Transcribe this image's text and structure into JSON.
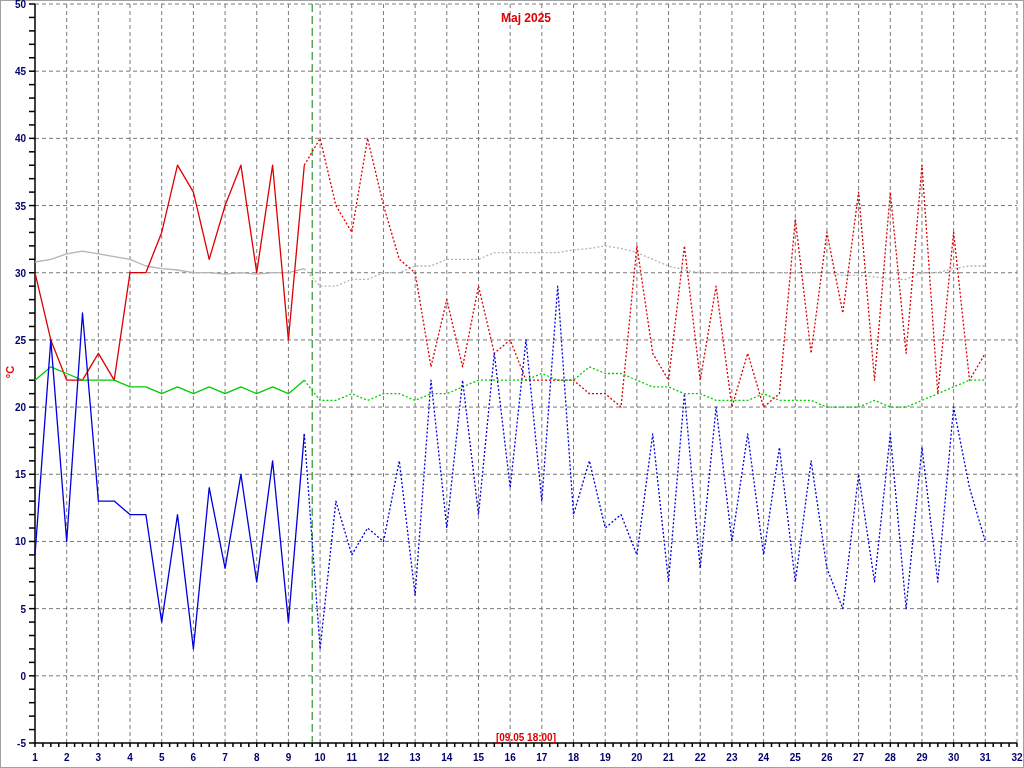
{
  "chart": {
    "chart_data": {
      "type": "line",
      "title": "Maj 2025",
      "ylabel": "°C",
      "x": [
        1,
        1.5,
        2,
        2.5,
        3,
        3.5,
        4,
        4.5,
        5,
        5.5,
        6,
        6.5,
        7,
        7.5,
        8,
        8.5,
        9,
        9.5,
        10,
        10.5,
        11,
        11.5,
        12,
        12.5,
        13,
        13.5,
        14,
        14.5,
        15,
        15.5,
        16,
        16.5,
        17,
        17.5,
        18,
        18.5,
        19,
        19.5,
        20,
        20.5,
        21,
        21.5,
        22,
        22.5,
        23,
        23.5,
        24,
        24.5,
        25,
        25.5,
        26,
        26.5,
        27,
        27.5,
        28,
        28.5,
        29,
        29.5,
        30,
        30.5,
        31
      ],
      "xlim": [
        1,
        32
      ],
      "ylim": [
        -5,
        50
      ],
      "xticks": [
        1,
        2,
        3,
        4,
        5,
        6,
        7,
        8,
        9,
        10,
        11,
        12,
        13,
        14,
        15,
        16,
        17,
        18,
        19,
        20,
        21,
        22,
        23,
        24,
        25,
        26,
        27,
        28,
        29,
        30,
        31,
        32
      ],
      "yticks": [
        -5,
        0,
        5,
        10,
        15,
        20,
        25,
        30,
        35,
        40,
        45,
        50
      ],
      "series": [
        {
          "color": "#b4b4b4",
          "line_style": "solid",
          "values": [
            30.8,
            31,
            31.4,
            31.6,
            31.4,
            31.2,
            31,
            30.5,
            30.3,
            30.2,
            30,
            30,
            29.9,
            30,
            29.9,
            30,
            30,
            30.3,
            null,
            null,
            null,
            null,
            null,
            null,
            null,
            null,
            null,
            null,
            null,
            null,
            null,
            null,
            null,
            null,
            null,
            null,
            null,
            null,
            null,
            null,
            null,
            null,
            null,
            null,
            null,
            null,
            null,
            null,
            null,
            null,
            null,
            null,
            null,
            null,
            null,
            null,
            null,
            null,
            null,
            null,
            null
          ]
        },
        {
          "color": "#b4b4b4",
          "line_style": "dotted",
          "values": [
            null,
            null,
            null,
            null,
            null,
            null,
            null,
            null,
            null,
            null,
            null,
            null,
            null,
            null,
            null,
            null,
            null,
            30.3,
            29,
            29,
            29.5,
            29.5,
            30,
            30,
            30.5,
            30.5,
            31,
            31,
            31,
            31.5,
            31.5,
            31.5,
            31.5,
            31.5,
            31.7,
            31.8,
            32,
            31.8,
            31.5,
            31,
            30.5,
            30.2,
            30,
            30,
            30,
            30,
            30,
            30,
            30,
            30,
            30,
            29.8,
            29.8,
            29.7,
            29.5,
            29.5,
            30,
            30,
            30.3,
            30.5,
            30.5
          ]
        },
        {
          "color": "#dd0000",
          "line_style": "solid",
          "values": [
            30,
            25,
            22,
            22,
            24,
            22,
            30,
            30,
            33,
            38,
            36,
            31,
            35,
            38,
            30,
            38,
            25,
            38,
            null,
            null,
            null,
            null,
            null,
            null,
            null,
            null,
            null,
            null,
            null,
            null,
            null,
            null,
            null,
            null,
            null,
            null,
            null,
            null,
            null,
            null,
            null,
            null,
            null,
            null,
            null,
            null,
            null,
            null,
            null,
            null,
            null,
            null,
            null,
            null,
            null,
            null,
            null,
            null,
            null,
            null,
            null
          ]
        },
        {
          "color": "#dd0000",
          "line_style": "dotted",
          "values": [
            null,
            null,
            null,
            null,
            null,
            null,
            null,
            null,
            null,
            null,
            null,
            null,
            null,
            null,
            null,
            null,
            null,
            38,
            40,
            35,
            33,
            40,
            35,
            31,
            30,
            23,
            28,
            23,
            29,
            24,
            25,
            22,
            22,
            22,
            22,
            21,
            21,
            20,
            32,
            24,
            22,
            32,
            22,
            29,
            20,
            24,
            20,
            21,
            34,
            24,
            33,
            27,
            36,
            22,
            36,
            24,
            38,
            21,
            33,
            22,
            24
          ]
        },
        {
          "color": "#00cc00",
          "line_style": "solid",
          "values": [
            22,
            23,
            22.5,
            22,
            22,
            22,
            21.5,
            21.5,
            21,
            21.5,
            21,
            21.5,
            21,
            21.5,
            21,
            21.5,
            21,
            22,
            null,
            null,
            null,
            null,
            null,
            null,
            null,
            null,
            null,
            null,
            null,
            null,
            null,
            null,
            null,
            null,
            null,
            null,
            null,
            null,
            null,
            null,
            null,
            null,
            null,
            null,
            null,
            null,
            null,
            null,
            null,
            null,
            null,
            null,
            null,
            null,
            null,
            null,
            null,
            null,
            null,
            null,
            null
          ]
        },
        {
          "color": "#00cc00",
          "line_style": "dotted",
          "values": [
            null,
            null,
            null,
            null,
            null,
            null,
            null,
            null,
            null,
            null,
            null,
            null,
            null,
            null,
            null,
            null,
            null,
            22,
            20.5,
            20.5,
            21,
            20.5,
            21,
            21,
            20.5,
            21,
            21,
            21.5,
            22,
            22,
            22,
            22,
            22.5,
            22,
            22,
            23,
            22.5,
            22.5,
            22,
            21.5,
            21.5,
            21,
            21,
            20.5,
            20.5,
            20.5,
            21,
            20.5,
            20.5,
            20.5,
            20,
            20,
            20,
            20.5,
            20,
            20,
            20.5,
            21,
            21.5,
            22,
            22
          ]
        },
        {
          "color": "#0000dd",
          "line_style": "solid",
          "values": [
            9,
            25,
            10,
            27,
            13,
            13,
            12,
            12,
            4,
            12,
            2,
            14,
            8,
            15,
            7,
            16,
            4,
            18,
            null,
            null,
            null,
            null,
            null,
            null,
            null,
            null,
            null,
            null,
            null,
            null,
            null,
            null,
            null,
            null,
            null,
            null,
            null,
            null,
            null,
            null,
            null,
            null,
            null,
            null,
            null,
            null,
            null,
            null,
            null,
            null,
            null,
            null,
            null,
            null,
            null,
            null,
            null,
            null,
            null,
            null,
            null
          ]
        },
        {
          "color": "#0000dd",
          "line_style": "dotted",
          "values": [
            null,
            null,
            null,
            null,
            null,
            null,
            null,
            null,
            null,
            null,
            null,
            null,
            null,
            null,
            null,
            null,
            null,
            18,
            2,
            13,
            9,
            11,
            10,
            16,
            6,
            22,
            11,
            22,
            12,
            24,
            14,
            25,
            13,
            29,
            12,
            16,
            11,
            12,
            9,
            18,
            7,
            21,
            8,
            20,
            10,
            18,
            9,
            17,
            7,
            16,
            8,
            5,
            15,
            7,
            18,
            5,
            17,
            7,
            20,
            14,
            10
          ]
        }
      ],
      "grid": true,
      "ref_lines": [
        {
          "axis": "x",
          "value": 9.75,
          "color": "#008000",
          "line_style": "dashed"
        }
      ],
      "annotations": [
        {
          "text": "[09.05 18:00]"
        }
      ]
    }
  }
}
